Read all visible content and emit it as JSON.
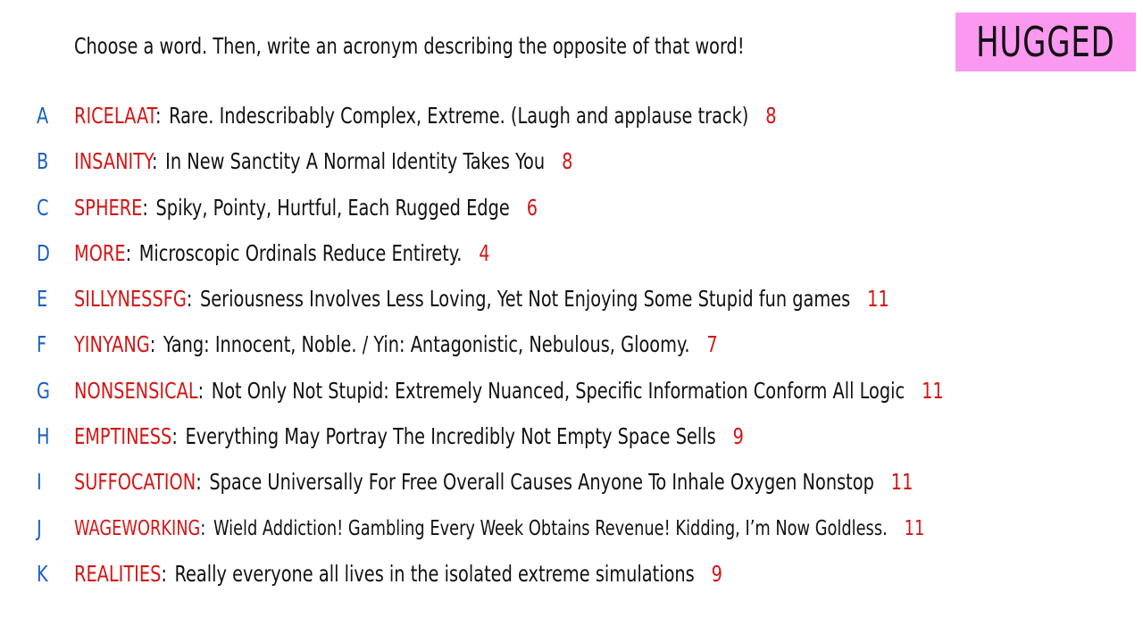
{
  "instruction": "Choose a word. Then, write an acronym describing the opposite of that word!",
  "player_name": "HUGGED",
  "colors": {
    "badge_background": "#fb98f0",
    "word": "#d41616",
    "score": "#d41616",
    "letter": "#1a5fc7",
    "text": "#111111"
  },
  "entries": [
    {
      "letter": "A",
      "word": "RICELAAT",
      "acronym": "Rare. Indescribably Complex, Extreme. (Laugh and applause track)",
      "score": "8"
    },
    {
      "letter": "B",
      "word": "INSANITY",
      "acronym": "In New Sanctity A Normal Identity Takes You",
      "score": "8"
    },
    {
      "letter": "C",
      "word": "SPHERE",
      "acronym": "Spiky, Pointy, Hurtful, Each Rugged Edge",
      "score": "6"
    },
    {
      "letter": "D",
      "word": "MORE",
      "acronym": "Microscopic Ordinals Reduce Entirety.",
      "score": "4"
    },
    {
      "letter": "E",
      "word": "SILLYNESSFG",
      "acronym": "Seriousness Involves Less Loving, Yet Not Enjoying Some Stupid fun games",
      "score": "11"
    },
    {
      "letter": "F",
      "word": "YINYANG",
      "acronym": "Yang: Innocent, Noble. / Yin: Antagonistic, Nebulous, Gloomy.",
      "score": "7"
    },
    {
      "letter": "G",
      "word": "NONSENSICAL",
      "acronym": "Not Only Not Stupid: Extremely Nuanced, Specific Information Conform All Logic",
      "score": "11"
    },
    {
      "letter": "H",
      "word": "EMPTINESS",
      "acronym": "Everything May Portray The Incredibly Not Empty Space Sells",
      "score": "9"
    },
    {
      "letter": "I",
      "word": "SUFFOCATION",
      "acronym": "Space Universally For Free Overall Causes Anyone To Inhale Oxygen Nonstop",
      "score": "11"
    },
    {
      "letter": "J",
      "word": "WAGEWORKING",
      "acronym": "Wield Addiction! Gambling Every Week Obtains Revenue! Kidding, I’m Now Goldless.",
      "score": "11"
    },
    {
      "letter": "K",
      "word": "REALITIES",
      "acronym": "Really everyone all lives in the isolated extreme simulations",
      "score": "9"
    }
  ]
}
